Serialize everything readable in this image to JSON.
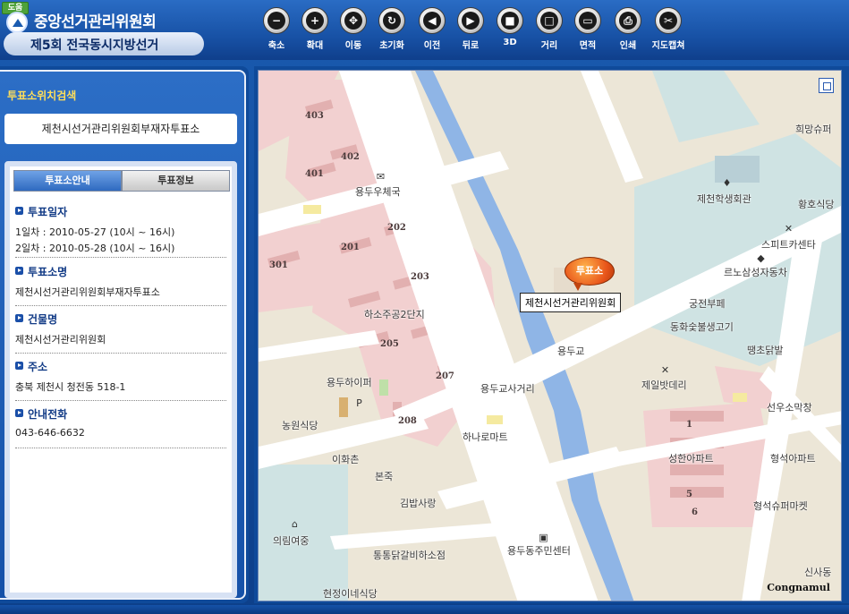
{
  "header": {
    "badge": "도움",
    "org_title": "중앙선거관리위원회",
    "election_title": "제5회 전국동시지방선거"
  },
  "toolbar": [
    {
      "label": "축소",
      "icon": "zoom-out-icon",
      "glyph": "−"
    },
    {
      "label": "확대",
      "icon": "zoom-in-icon",
      "glyph": "+"
    },
    {
      "label": "이동",
      "icon": "move-icon",
      "glyph": "✥"
    },
    {
      "label": "초기화",
      "icon": "reset-icon",
      "glyph": "↻"
    },
    {
      "label": "이전",
      "icon": "back-icon",
      "glyph": "◀"
    },
    {
      "label": "뒤로",
      "icon": "forward-icon",
      "glyph": "▶"
    },
    {
      "label": "3D",
      "icon": "3d-icon",
      "glyph": "■"
    },
    {
      "label": "거리",
      "icon": "distance-icon",
      "glyph": "□"
    },
    {
      "label": "면적",
      "icon": "area-icon",
      "glyph": "▭"
    },
    {
      "label": "인쇄",
      "icon": "print-icon",
      "glyph": "⎙"
    },
    {
      "label": "지도캡쳐",
      "icon": "capture-icon",
      "glyph": "✂"
    }
  ],
  "side": {
    "search_title": "투표소위치검색",
    "search_value": "제천시선거관리위원회부재자투표소",
    "tabs": [
      "투표소안내",
      "투표정보"
    ],
    "sections": [
      {
        "title": "투표일자",
        "lines": [
          "1일차 : 2010-05-27 (10시 ~ 16시)",
          "2일차 : 2010-05-28 (10시 ~ 16시)"
        ]
      },
      {
        "title": "투표소명",
        "lines": [
          "제천시선거관리위원회부재자투표소"
        ]
      },
      {
        "title": "건물명",
        "lines": [
          "제천시선거관리위원회"
        ]
      },
      {
        "title": "주소",
        "lines": [
          "충북 제천시 청전동 518-1"
        ]
      },
      {
        "title": "안내전화",
        "lines": [
          "043-646-6632"
        ]
      }
    ]
  },
  "map": {
    "marker_text": "투표소",
    "office_label": "제천시선거관리위원회",
    "copyright": "Congnamul",
    "block_numbers": [
      "403",
      "402",
      "401",
      "301",
      "201",
      "202",
      "203",
      "205",
      "207",
      "208",
      "1",
      "5",
      "6"
    ],
    "place_labels": [
      "희망슈퍼",
      "용두우체국",
      "제천학생회관",
      "황호식당",
      "스피트카센타",
      "르노삼성자동차",
      "궁전부페",
      "동화숯불생고기",
      "하소주공2단지",
      "땡초닭발",
      "용두교",
      "용두교사거리",
      "제일밧데리",
      "용두하이퍼",
      "선우소막창",
      "농원식당",
      "하나로마트",
      "성한아파트",
      "형석아파트",
      "이화촌",
      "본죽",
      "김밥사랑",
      "형석슈퍼마켓",
      "의림여중",
      "통통닭갈비하소점",
      "용두동주민센터",
      "신사동",
      "현정이네식당"
    ]
  }
}
